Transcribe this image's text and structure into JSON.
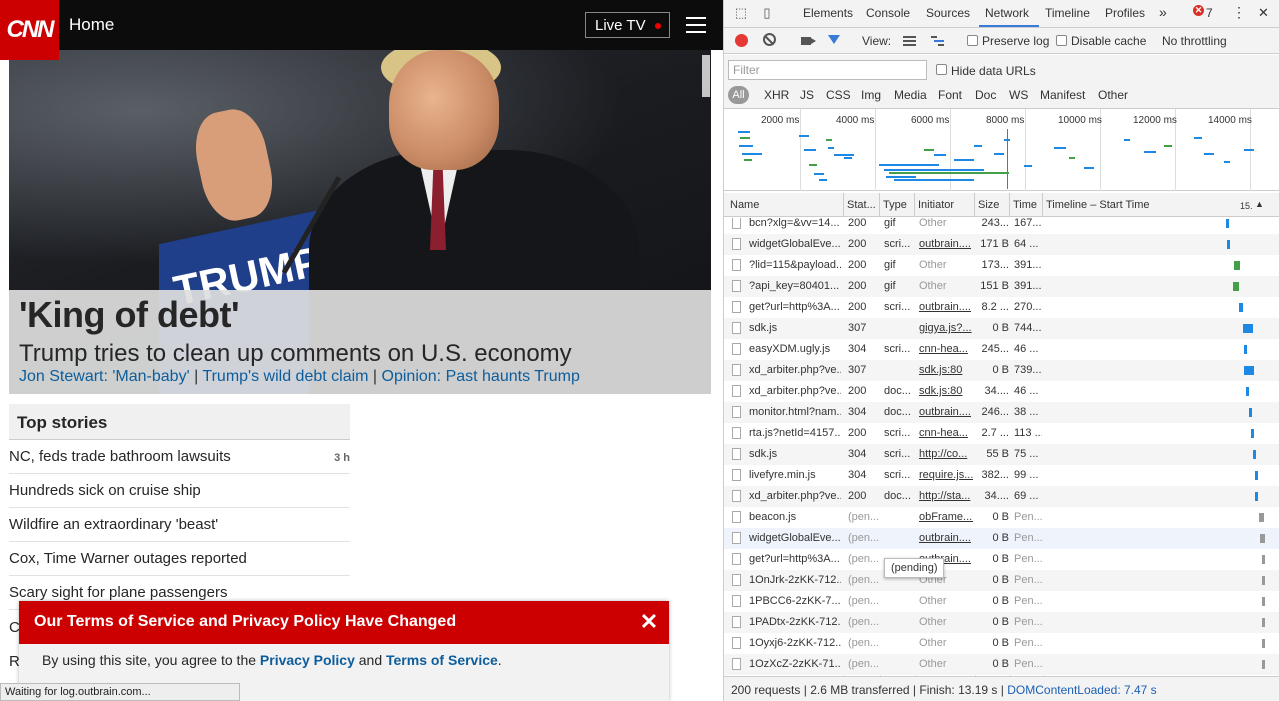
{
  "cnn": {
    "logo": "CNN",
    "nav_title": "Home",
    "live_tv": "Live TV",
    "hero": {
      "podium_text": "TRUMP",
      "title": "'King of debt'",
      "subtitle": "Trump tries to clean up comments on U.S. economy",
      "links": [
        "Jon Stewart: 'Man-baby'",
        "Trump's wild debt claim",
        "Opinion: Past haunts Trump"
      ],
      "separator": "|"
    },
    "top_stories": {
      "heading": "Top stories",
      "items": [
        {
          "text": "NC, feds trade bathroom lawsuits",
          "time": "3 h"
        },
        {
          "text": "Hundreds sick on cruise ship",
          "time": ""
        },
        {
          "text": "Wildfire an extraordinary 'beast'",
          "time": ""
        },
        {
          "text": "Cox, Time Warner outages reported",
          "time": ""
        },
        {
          "text": "Scary sight for plane passengers",
          "time": ""
        }
      ],
      "partial_items": [
        "C",
        "R"
      ]
    },
    "tos_banner": {
      "title": "Our Terms of Service and Privacy Policy Have Changed",
      "close": "✕",
      "body_prefix": "By using this site, you agree to the",
      "privacy_link": "Privacy Policy",
      "and": "and",
      "terms_link": "Terms of Service",
      "suffix": "."
    },
    "status_text": "Waiting for log.outbrain.com..."
  },
  "devtools": {
    "tabs": [
      "Elements",
      "Console",
      "Sources",
      "Network",
      "Timeline",
      "Profiles"
    ],
    "active_tab": "Network",
    "more": "»",
    "error_count": "7",
    "error_icon": "✕",
    "kebab": "⋮",
    "close": "✕",
    "toolbar": {
      "view_label": "View:",
      "preserve_log": "Preserve log",
      "disable_cache": "Disable cache",
      "throttling": "No throttling"
    },
    "filter_placeholder": "Filter",
    "hide_data_urls": "Hide data URLs",
    "types": [
      "All",
      "XHR",
      "JS",
      "CSS",
      "Img",
      "Media",
      "Font",
      "Doc",
      "WS",
      "Manifest",
      "Other"
    ],
    "overview_ticks": [
      "2000 ms",
      "4000 ms",
      "6000 ms",
      "8000 ms",
      "10000 ms",
      "12000 ms",
      "14000 ms"
    ],
    "columns": [
      "Name",
      "Stat...",
      "Type",
      "Initiator",
      "Size",
      "Time",
      "Timeline – Start Time",
      "15."
    ],
    "rows": [
      {
        "name": "bcn?xlg=&vv=14...",
        "status": "200",
        "type": "gif",
        "initiator": "Other",
        "size": "243...",
        "time": "167..."
      },
      {
        "name": "widgetGlobalEve...",
        "status": "200",
        "type": "scri...",
        "initiator": "outbrain....",
        "size": "171 B",
        "time": "64 ..."
      },
      {
        "name": "?lid=115&payload...",
        "status": "200",
        "type": "gif",
        "initiator": "Other",
        "size": "173...",
        "time": "391..."
      },
      {
        "name": "?api_key=80401...",
        "status": "200",
        "type": "gif",
        "initiator": "Other",
        "size": "151 B",
        "time": "391..."
      },
      {
        "name": "get?url=http%3A...",
        "status": "200",
        "type": "scri...",
        "initiator": "outbrain....",
        "size": "8.2 ...",
        "time": "270..."
      },
      {
        "name": "sdk.js",
        "status": "307",
        "type": "",
        "initiator": "gigya.js?...",
        "size": "0 B",
        "time": "744..."
      },
      {
        "name": "easyXDM.ugly.js",
        "status": "304",
        "type": "scri...",
        "initiator": "cnn-hea...",
        "size": "245...",
        "time": "46 ..."
      },
      {
        "name": "xd_arbiter.php?ve...",
        "status": "307",
        "type": "",
        "initiator": "sdk.js:80",
        "size": "0 B",
        "time": "739..."
      },
      {
        "name": "xd_arbiter.php?ve...",
        "status": "200",
        "type": "doc...",
        "initiator": "sdk.js:80",
        "size": "34....",
        "time": "46 ..."
      },
      {
        "name": "monitor.html?nam...",
        "status": "304",
        "type": "doc...",
        "initiator": "outbrain....",
        "size": "246...",
        "time": "38 ..."
      },
      {
        "name": "rta.js?netId=4157...",
        "status": "200",
        "type": "scri...",
        "initiator": "cnn-hea...",
        "size": "2.7 ...",
        "time": "113 ..."
      },
      {
        "name": "sdk.js",
        "status": "304",
        "type": "scri...",
        "initiator": "http://co...",
        "size": "55 B",
        "time": "75 ..."
      },
      {
        "name": "livefyre.min.js",
        "status": "304",
        "type": "scri...",
        "initiator": "require.js...",
        "size": "382...",
        "time": "99 ..."
      },
      {
        "name": "xd_arbiter.php?ve...",
        "status": "200",
        "type": "doc...",
        "initiator": "http://sta...",
        "size": "34....",
        "time": "69 ..."
      },
      {
        "name": "beacon.js",
        "status": "(pen...",
        "type": "",
        "initiator": "obFrame....",
        "size": "0 B",
        "time": "Pen..."
      },
      {
        "name": "widgetGlobalEve...",
        "status": "(pen...",
        "type": "",
        "initiator": "outbrain....",
        "size": "0 B",
        "time": "Pen..."
      },
      {
        "name": "get?url=http%3A...",
        "status": "(pen...",
        "type": "",
        "initiator": "outbrain....",
        "size": "0 B",
        "time": "Pen..."
      },
      {
        "name": "1OnJrk-2zKK-712...",
        "status": "(pen...",
        "type": "",
        "initiator": "Other",
        "size": "0 B",
        "time": "Pen..."
      },
      {
        "name": "1PBCC6-2zKK-7...",
        "status": "(pen...",
        "type": "",
        "initiator": "Other",
        "size": "0 B",
        "time": "Pen..."
      },
      {
        "name": "1PADtx-2zKK-712...",
        "status": "(pen...",
        "type": "",
        "initiator": "Other",
        "size": "0 B",
        "time": "Pen..."
      },
      {
        "name": "1Oyxj6-2zKK-712...",
        "status": "(pen...",
        "type": "",
        "initiator": "Other",
        "size": "0 B",
        "time": "Pen..."
      },
      {
        "name": "1OzXcZ-2zKK-71...",
        "status": "(pen...",
        "type": "",
        "initiator": "Other",
        "size": "0 B",
        "time": "Pen..."
      }
    ],
    "tooltip": "(pending)",
    "status": {
      "requests": "200 requests",
      "transferred": "2.6 MB transferred",
      "finish": "Finish: 13.19 s",
      "dcl": "DOMContentLoaded: 7.47 s",
      "sep": "|"
    }
  },
  "colors": {
    "cnn_red": "#cc0000",
    "link_blue": "#0c5d9c",
    "devtools_blue": "#3879d9",
    "waterfall_blue": "#1e88e5",
    "waterfall_green": "#43a047"
  }
}
